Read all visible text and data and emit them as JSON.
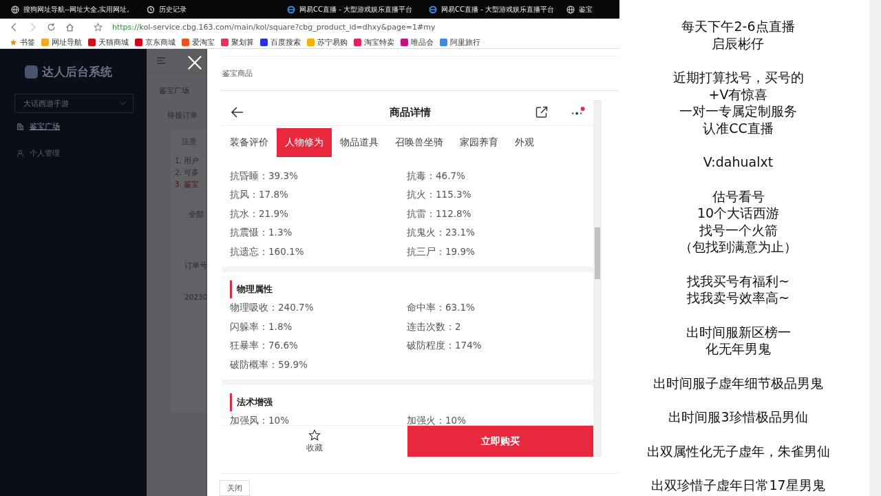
{
  "browser": {
    "tabs": [
      {
        "title": "搜狗网址导航--网址大全,实用网址,",
        "kind": "globe"
      },
      {
        "title": "历史记录",
        "kind": "history"
      },
      {
        "title": "网易CC直播 - 大型游戏娱乐直播平台",
        "kind": "ie"
      },
      {
        "title": "网易CC直播 - 大型游戏娱乐直播平台",
        "kind": "ie"
      },
      {
        "title": "鉴宝",
        "kind": "globe"
      }
    ],
    "address": {
      "scheme": "https://",
      "rest": "kol-service.cbg.163.com/main/kol/square?cbg_product_id=dhxy&page=1#my"
    },
    "bookmarks": [
      {
        "label": "书签",
        "color": "#f08c00"
      },
      {
        "label": "网址导航",
        "color": "#f5a623"
      },
      {
        "label": "天猫商城",
        "color": "#c4161c"
      },
      {
        "label": "京东商城",
        "color": "#d0021b"
      },
      {
        "label": "爱淘宝",
        "color": "#f04e23"
      },
      {
        "label": "聚划算",
        "color": "#e6325a"
      },
      {
        "label": "百度搜索",
        "color": "#2932e1"
      },
      {
        "label": "苏宁易购",
        "color": "#f5b000"
      },
      {
        "label": "淘宝特卖",
        "color": "#e0245e"
      },
      {
        "label": "唯品会",
        "color": "#c0137f"
      },
      {
        "label": "阿里旅行",
        "color": "#3b8de0"
      }
    ]
  },
  "sidebar": {
    "title": "达人后台系统",
    "game_select": "大话西游手游",
    "items": [
      {
        "label": "鉴宝广场",
        "kind": "building",
        "selected": true
      },
      {
        "label": "个人管理",
        "kind": "user",
        "selected": false
      }
    ]
  },
  "background_page": {
    "breadcrumb": "鉴宝广场",
    "tab": "待接订单",
    "notice_title": "注意",
    "notice_items": [
      {
        "number": "1.",
        "text": "用户",
        "warning": false
      },
      {
        "number": "2.",
        "text": "可多",
        "warning": false
      },
      {
        "number": "3.",
        "text": "鉴宝",
        "warning": true
      }
    ],
    "filter": "全部",
    "column_1": "订单号",
    "row_1": "20230"
  },
  "modal": {
    "title": "鉴宝商品",
    "close_button": "关闭",
    "product": {
      "title": "商品详情",
      "tabs": [
        {
          "label": "装备评价",
          "selected": false
        },
        {
          "label": "人物修为",
          "selected": true
        },
        {
          "label": "物品道具",
          "selected": false
        },
        {
          "label": "召唤兽坐骑",
          "selected": false
        },
        {
          "label": "家园养育",
          "selected": false
        },
        {
          "label": "外观",
          "selected": false
        }
      ],
      "sections": [
        {
          "rows": [
            [
              "抗昏睡：39.3%",
              "抗毒：46.7%"
            ],
            [
              "抗风：17.8%",
              "抗火：115.3%"
            ],
            [
              "抗水：21.9%",
              "抗雷：112.8%"
            ],
            [
              "抗震慑：1.3%",
              "抗鬼火：23.1%"
            ],
            [
              "抗遗忘：160.1%",
              "抗三尸：19.9%"
            ]
          ]
        },
        {
          "title": "物理属性",
          "rows": [
            [
              "物理吸收：240.7%",
              "命中率：63.1%"
            ],
            [
              "闪躲率：1.8%",
              "连击次数：2"
            ],
            [
              "狂暴率：76.6%",
              "破防程度：174%"
            ],
            [
              "破防概率：59.9%"
            ]
          ]
        },
        {
          "title": "法术增强",
          "rows": [
            [
              "加强风：10%",
              "加强火：10%"
            ]
          ]
        }
      ],
      "favorite": "收藏",
      "buy_button": "立即购买",
      "has_notification": true
    }
  },
  "stream_notes": [
    [
      "每天下午2-6点直播",
      "启辰彬仔"
    ],
    [
      "近期打算找号，买号的",
      "+V有惊喜",
      "一对一专属定制服务",
      "认准CC直播"
    ],
    [
      "V:dahualxt"
    ],
    [
      "估号看号",
      "10个大话西游",
      "找号一个火箭",
      "（包找到满意为止）"
    ],
    [
      "找我买号有福利~",
      "找我卖号效率高~"
    ],
    [
      "出时间服新区榜一",
      "化无年男鬼"
    ],
    [
      "出时间服子虚年细节极品男鬼"
    ],
    [
      "出时间服3珍惜极品男仙"
    ],
    [
      "出双属性化无子虚年，朱雀男仙"
    ],
    [
      "出双珍惜子虚年日常17星男鬼"
    ]
  ]
}
